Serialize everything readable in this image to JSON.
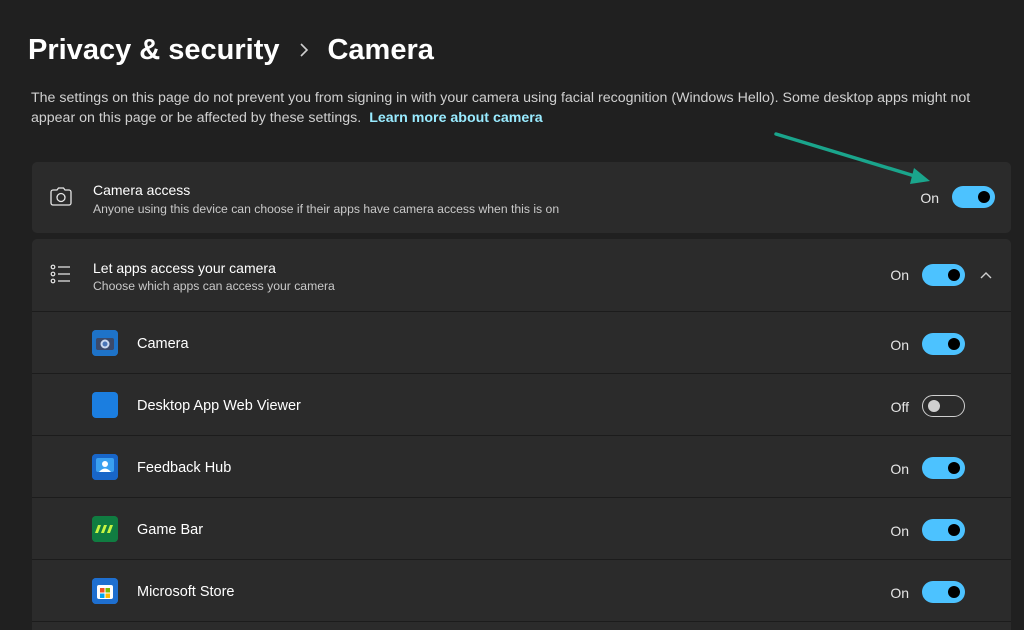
{
  "breadcrumb": {
    "parent": "Privacy & security",
    "current": "Camera"
  },
  "description": {
    "text": "The settings on this page do not prevent you from signing in with your camera using facial recognition (Windows Hello). Some desktop apps might not appear on this page or be affected by these settings.",
    "link": "Learn more about camera"
  },
  "camera_access": {
    "title": "Camera access",
    "subtitle": "Anyone using this device can choose if their apps have camera access when this is on",
    "state": "On",
    "icon": "camera-icon"
  },
  "let_apps": {
    "title": "Let apps access your camera",
    "subtitle": "Choose which apps can access your camera",
    "state": "On",
    "icon": "list-icon",
    "expanded": true
  },
  "apps": [
    {
      "name": "Camera",
      "state": "On",
      "icon": "camera-app-icon"
    },
    {
      "name": "Desktop App Web Viewer",
      "state": "Off",
      "icon": "web-viewer-icon"
    },
    {
      "name": "Feedback Hub",
      "state": "On",
      "icon": "feedback-hub-icon"
    },
    {
      "name": "Game Bar",
      "state": "On",
      "icon": "game-bar-icon"
    },
    {
      "name": "Microsoft Store",
      "state": "On",
      "icon": "store-icon"
    }
  ],
  "colors": {
    "accent": "#4cc2ff",
    "link": "#99ebff",
    "annotation_arrow": "#1aa58c",
    "background": "#202020",
    "card": "#2b2b2b"
  }
}
